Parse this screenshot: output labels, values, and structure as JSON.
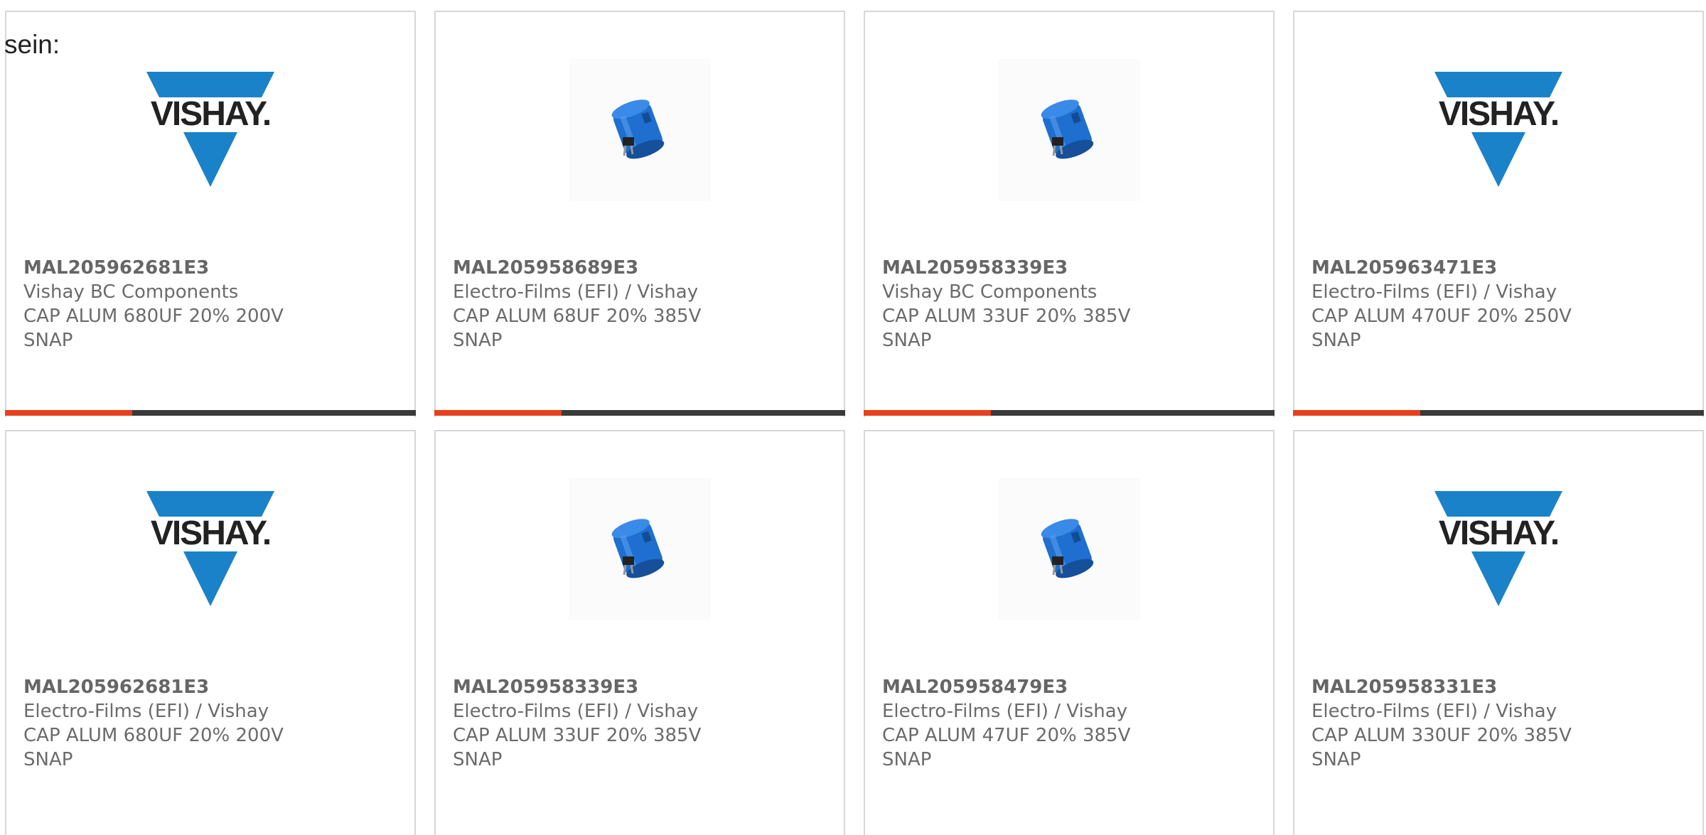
{
  "page_label": "sein:",
  "colors": {
    "accent": "#e8401c",
    "track": "#3a3a3a",
    "vishay_blue": "#1a82c8",
    "capacitor_blue": "#1e6fd0"
  },
  "products": [
    {
      "part_number": "MAL205962681E3",
      "manufacturer": "Vishay BC Components",
      "description": "CAP ALUM 680UF 20% 200V SNAP",
      "image": "vishay-logo",
      "progress": 0.31
    },
    {
      "part_number": "MAL205958689E3",
      "manufacturer": "Electro-Films (EFI) / Vishay",
      "description": "CAP ALUM 68UF 20% 385V SNAP",
      "image": "capacitor-photo",
      "progress": 0.31
    },
    {
      "part_number": "MAL205958339E3",
      "manufacturer": "Vishay BC Components",
      "description": "CAP ALUM 33UF 20% 385V SNAP",
      "image": "capacitor-photo",
      "progress": 0.31
    },
    {
      "part_number": "MAL205963471E3",
      "manufacturer": "Electro-Films (EFI) / Vishay",
      "description": "CAP ALUM 470UF 20% 250V SNAP",
      "image": "vishay-logo",
      "progress": 0.31
    },
    {
      "part_number": "MAL205962681E3",
      "manufacturer": "Electro-Films (EFI) / Vishay",
      "description": "CAP ALUM 680UF 20% 200V SNAP",
      "image": "vishay-logo"
    },
    {
      "part_number": "MAL205958339E3",
      "manufacturer": "Electro-Films (EFI) / Vishay",
      "description": "CAP ALUM 33UF 20% 385V SNAP",
      "image": "capacitor-photo"
    },
    {
      "part_number": "MAL205958479E3",
      "manufacturer": "Electro-Films (EFI) / Vishay",
      "description": "CAP ALUM 47UF 20% 385V SNAP",
      "image": "capacitor-photo"
    },
    {
      "part_number": "MAL205958331E3",
      "manufacturer": "Electro-Films (EFI) / Vishay",
      "description": "CAP ALUM 330UF 20% 385V SNAP",
      "image": "vishay-logo"
    }
  ],
  "logo": {
    "text": "VISHAY."
  }
}
